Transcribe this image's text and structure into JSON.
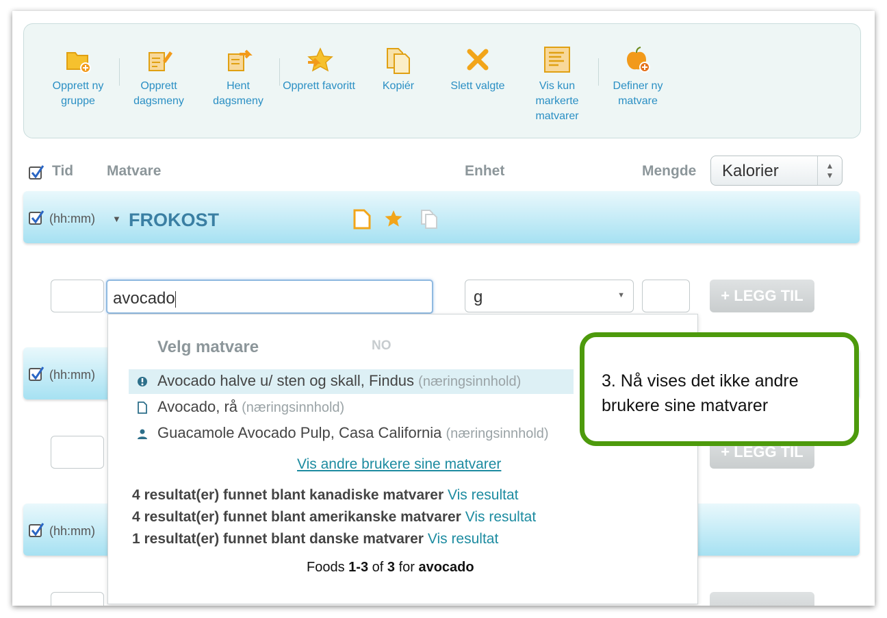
{
  "toolbar": {
    "items": [
      {
        "label": "Opprett ny gruppe",
        "icon": "new-group-icon"
      },
      {
        "label": "Opprett dagsmeny",
        "icon": "create-menu-icon"
      },
      {
        "label": "Hent dagsmeny",
        "icon": "fetch-menu-icon"
      },
      {
        "label": "Opprett favoritt",
        "icon": "favorite-star-icon"
      },
      {
        "label": "Kopiér",
        "icon": "copy-icon"
      },
      {
        "label": "Slett valgte",
        "icon": "delete-x-icon"
      },
      {
        "label": "Vis kun markerte matvarer",
        "icon": "list-icon"
      },
      {
        "label": "Definer ny matvare",
        "icon": "apple-add-icon"
      }
    ]
  },
  "columns": {
    "tid": "Tid",
    "matvare": "Matvare",
    "enhet": "Enhet",
    "mengde": "Mengde",
    "measure_select": "Kalorier"
  },
  "meals": [
    {
      "time_placeholder": "(hh:mm)",
      "name": "FROKOST"
    },
    {
      "time_placeholder": "(hh:mm)"
    },
    {
      "time_placeholder": "(hh:mm)"
    }
  ],
  "entry": {
    "search_value": "avocado",
    "unit_value": "g",
    "add_label": "+ LEGG TIL"
  },
  "dropdown": {
    "title": "Velg matvare",
    "lang": "NO",
    "results": [
      {
        "name": "Avocado halve u/ sten og skall, Findus",
        "suffix": "(næringsinnhold)"
      },
      {
        "name": "Avocado, rå",
        "suffix": "(næringsinnhold)"
      },
      {
        "name": "Guacamole Avocado Pulp, Casa California",
        "suffix": "(næringsinnhold)"
      }
    ],
    "show_others_link": "Vis andre brukere sine matvarer",
    "found": [
      {
        "text": "4 resultat(er) funnet blant kanadiske matvarer",
        "link": "Vis resultat"
      },
      {
        "text": "4 resultat(er) funnet blant amerikanske matvarer",
        "link": "Vis resultat"
      },
      {
        "text": "1 resultat(er) funnet blant danske matvarer",
        "link": "Vis resultat"
      }
    ],
    "footer": {
      "prefix": "Foods",
      "range": "1-3",
      "of": "of",
      "total": "3",
      "for": "for",
      "query": "avocado"
    }
  },
  "callout": {
    "text": "3. Nå vises det ikke andre brukere sine matvarer"
  },
  "colors": {
    "accent": "#2a8fc4",
    "callout_border": "#4d9a0c",
    "icon_orange": "#f2a51a"
  }
}
